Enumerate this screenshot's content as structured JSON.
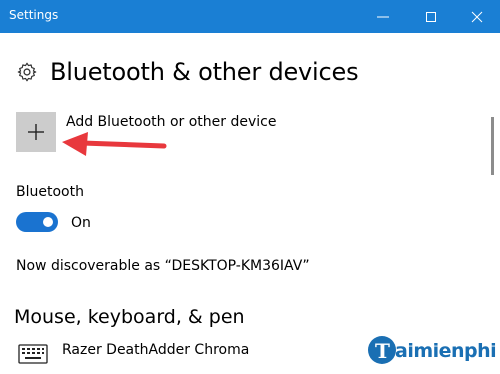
{
  "window": {
    "title": "Settings"
  },
  "page": {
    "title": "Bluetooth & other devices",
    "icon": "gear-icon"
  },
  "add_device": {
    "label": "Add Bluetooth or other device",
    "icon": "plus-icon"
  },
  "bluetooth": {
    "label": "Bluetooth",
    "state": "On",
    "enabled": true
  },
  "discoverable": "Now discoverable as “DESKTOP-KM36IAV”",
  "section": {
    "title": "Mouse, keyboard, & pen"
  },
  "devices": [
    {
      "name": "Razer DeathAdder Chroma",
      "icon": "keyboard-icon"
    }
  ],
  "watermark": {
    "text": "Taimienphi"
  },
  "colors": {
    "titlebar": "#1a7fd4",
    "toggle_on": "#1a73d0",
    "arrow": "#e8383d",
    "button_bg": "#cccccc"
  }
}
